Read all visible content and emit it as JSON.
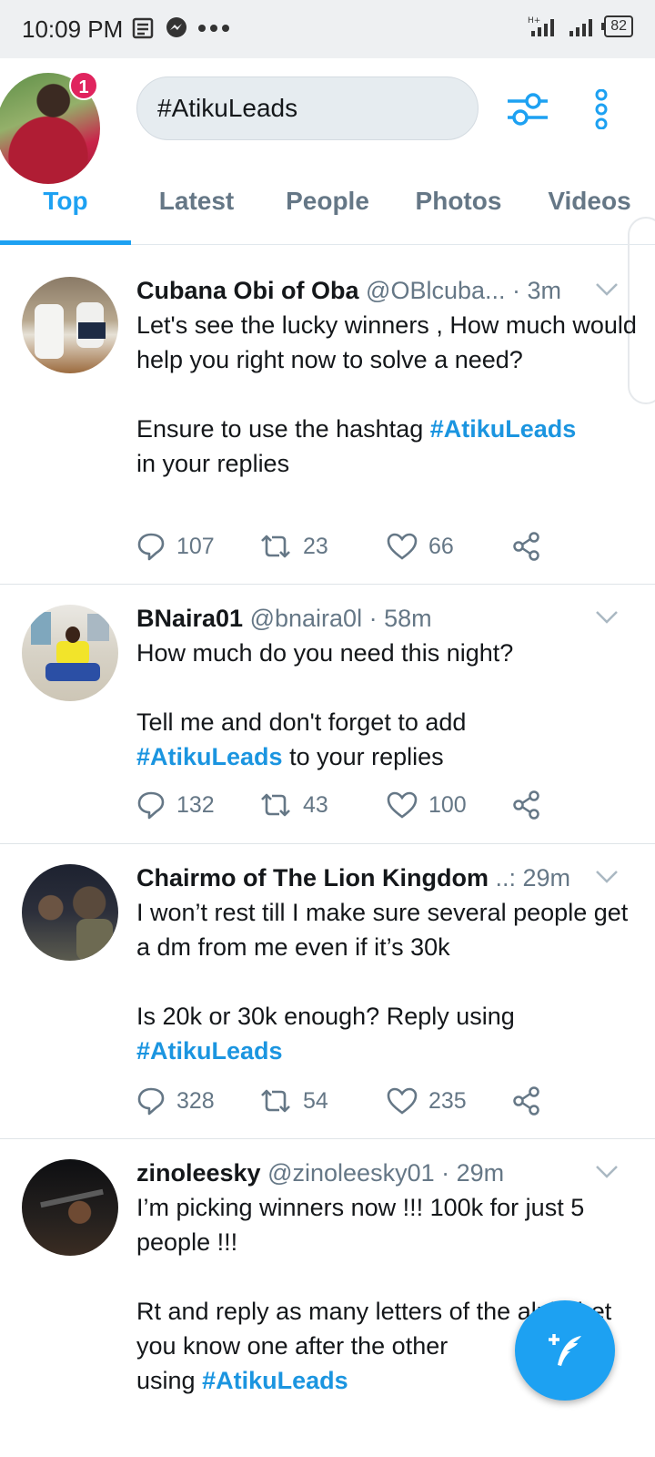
{
  "status_bar": {
    "time": "10:09 PM",
    "battery": "82"
  },
  "header": {
    "notification_count": "1",
    "search_query": "#AtikuLeads"
  },
  "tabs": [
    "Top",
    "Latest",
    "People",
    "Photos",
    "Videos"
  ],
  "tweets": [
    {
      "name": "Cubana Obi of Oba",
      "handle": "@OBlcuba...",
      "time": "3m",
      "paragraphs": [
        "Let's see the lucky winners , How much would help you right now to solve a need?",
        "",
        "Ensure to use the hashtag ",
        "in your replies"
      ],
      "hashtag": "#AtikuLeads",
      "replies": "107",
      "retweets": "23",
      "likes": "66"
    },
    {
      "name": "BNaira01",
      "handle": "@bnaira0l",
      "time": "58m",
      "paragraphs": [
        "How much do you need this night?",
        "",
        "Tell me and don't forget to add",
        " to your replies"
      ],
      "hashtag": "#AtikuLeads",
      "replies": "132",
      "retweets": "43",
      "likes": "100"
    },
    {
      "name": "Chairmo of The Lion Kingdom",
      "handle": "..:",
      "time": "29m",
      "paragraphs": [
        "I won’t rest till I make sure several people get a dm from me even if it’s 30k",
        "",
        "Is 20k or 30k enough? Reply using"
      ],
      "hashtag": "#AtikuLeads",
      "replies": "328",
      "retweets": "54",
      "likes": "235"
    },
    {
      "name": "zinoleesky",
      "handle": "@zinoleesky01",
      "time": "29m",
      "paragraphs": [
        "I’m picking winners now !!! 100k for just 5 people  !!!",
        "",
        "Rt and reply as many letters of the alphabet you know one after the other",
        "using "
      ],
      "hashtag": "#AtikuLeads"
    }
  ],
  "colors": {
    "accent": "#1da1f2",
    "hashtag": "#1b95e0",
    "badge": "#e0245e",
    "muted": "#657786"
  },
  "icons": [
    "filter-icon",
    "more-vert-icon",
    "chevron-down-icon",
    "reply-icon",
    "retweet-icon",
    "like-icon",
    "share-icon",
    "compose-tweet-icon"
  ]
}
